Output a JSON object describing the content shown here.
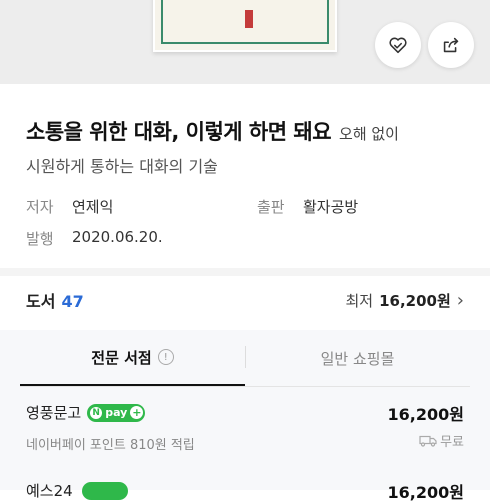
{
  "book": {
    "title": "소통을 위한 대화, 이렇게 하면 돼요",
    "author_inline": "오해 없이",
    "subtitle": "시원하게 통하는 대화의 기술"
  },
  "meta": {
    "author_label": "저자",
    "author_value": "연제익",
    "publisher_label": "출판",
    "publisher_value": "활자공방",
    "published_label": "발행",
    "published_value": "2020.06.20."
  },
  "section": {
    "title": "도서",
    "count": "47",
    "lowest_label": "최저",
    "lowest_price": "16,200원",
    "arrow": "›"
  },
  "tabs": {
    "active": "전문 서점",
    "info_glyph": "!",
    "inactive": "일반 쇼핑몰"
  },
  "offers": [
    {
      "store": "영풍문고",
      "npay_label": "pay",
      "npay_n": "N",
      "npay_plus": "+",
      "price": "16,200원",
      "points": "네이버페이 포인트 810원 적립",
      "shipping": "무료"
    },
    {
      "store": "예스24",
      "price": "16,200원"
    }
  ],
  "icons": {
    "wishlist": "heart-check-icon",
    "share": "share-icon",
    "truck": "truck-icon"
  },
  "colors": {
    "accent_blue": "#2b6bd6",
    "npay_green": "#2fb84a"
  }
}
